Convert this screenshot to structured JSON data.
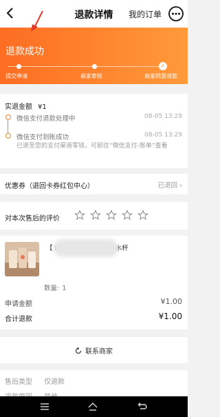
{
  "header": {
    "title": "退款详情",
    "my_orders": "我的订单"
  },
  "banner": {
    "status": "退款成功",
    "steps": [
      "提交申请",
      "商家审核",
      "商家同意退款"
    ]
  },
  "refund": {
    "amount_label": "实退金额",
    "amount_value": "¥1",
    "timeline": [
      {
        "text": "微信支付退款处理中",
        "time": "08-05 13:29"
      },
      {
        "text": "微信支付到账成功",
        "time": "08-05 13:29",
        "note": "已退至您的支付渠道零钱，可前往“微信支付-账单”查看"
      }
    ]
  },
  "coupon": {
    "label": "优惠券（退回卡券红包中心）",
    "status": "已退回"
  },
  "review": {
    "label": "对本次售后的评价",
    "stars": 5
  },
  "product": {
    "name": "【                         i肚杯夏季大容量水杯水杯",
    "quantity_label": "数量:",
    "quantity": "1"
  },
  "amounts": {
    "apply_label": "申请金额",
    "apply_value": "¥1.00",
    "total_label": "合计退款",
    "total_value": "¥1.00"
  },
  "contact": {
    "label": "联系商家"
  },
  "details": [
    {
      "label": "售后类型",
      "value": "仅退款"
    },
    {
      "label": "退款原因",
      "value": "其他"
    }
  ],
  "colors": {
    "accent": "#fd6d22",
    "timeline": "#e8852b"
  }
}
